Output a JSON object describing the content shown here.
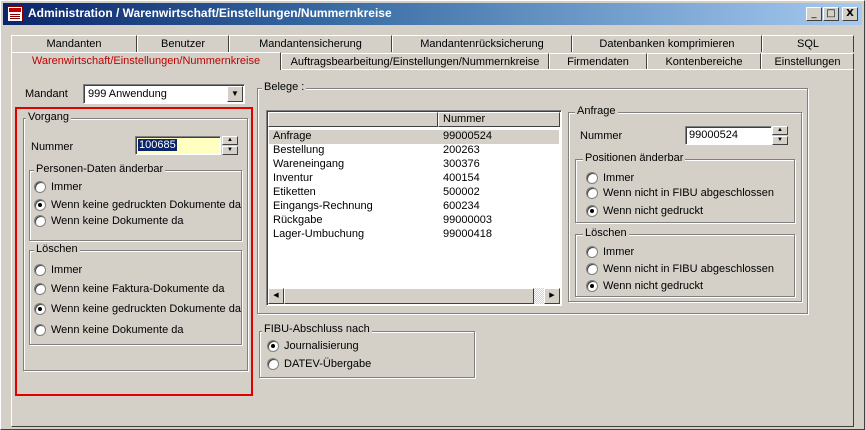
{
  "window": {
    "title": "Administration / Warenwirtschaft/Einstellungen/Nummernkreise",
    "minimize_label": "_",
    "maximize_label": "□",
    "close_label": "X"
  },
  "tabs_row1": [
    {
      "label": "Mandanten"
    },
    {
      "label": "Benutzer"
    },
    {
      "label": "Mandantensicherung"
    },
    {
      "label": "Mandantenrücksicherung"
    },
    {
      "label": "Datenbanken komprimieren"
    },
    {
      "label": "SQL"
    }
  ],
  "tabs_row2": [
    {
      "label": "Warenwirtschaft/Einstellungen/Nummernkreise",
      "active": true
    },
    {
      "label": "Auftragsbearbeitung/Einstellungen/Nummernkreise"
    },
    {
      "label": "Firmendaten"
    },
    {
      "label": "Kontenbereiche"
    },
    {
      "label": "Einstellungen"
    }
  ],
  "mandant": {
    "label": "Mandant",
    "value": "999 Anwendung"
  },
  "vorgang": {
    "title": "Vorgang",
    "nummer_label": "Nummer",
    "nummer_value": "100685",
    "personen": {
      "title": "Personen-Daten änderbar",
      "options": [
        "Immer",
        "Wenn keine gedruckten Dokumente da",
        "Wenn keine  Dokumente da"
      ],
      "selected": 1
    },
    "loeschen": {
      "title": "Löschen",
      "options": [
        "Immer",
        "Wenn keine  Faktura-Dokumente da",
        "Wenn keine gedruckten Dokumente da",
        "Wenn keine  Dokumente da"
      ],
      "selected": 2
    }
  },
  "belege": {
    "title": "Belege :",
    "columns": [
      "",
      "Nummer"
    ],
    "rows": [
      {
        "name": "Anfrage",
        "nummer": "99000524"
      },
      {
        "name": "Bestellung",
        "nummer": "200263"
      },
      {
        "name": "Wareneingang",
        "nummer": "300376"
      },
      {
        "name": "Inventur",
        "nummer": "400154"
      },
      {
        "name": "Etiketten",
        "nummer": "500002"
      },
      {
        "name": "Eingangs-Rechnung",
        "nummer": "600234"
      },
      {
        "name": "Rückgabe",
        "nummer": "99000003"
      },
      {
        "name": "Lager-Umbuchung",
        "nummer": "99000418"
      }
    ]
  },
  "anfrage": {
    "title": "Anfrage",
    "nummer_label": "Nummer",
    "nummer_value": "99000524",
    "positionen": {
      "title": "Positionen änderbar",
      "options": [
        "Immer",
        "Wenn nicht in FIBU abgeschlossen",
        "Wenn nicht gedruckt"
      ],
      "selected": 2
    },
    "loeschen": {
      "title": "Löschen",
      "options": [
        "Immer",
        "Wenn nicht in FIBU abgeschlossen",
        "Wenn nicht gedruckt"
      ],
      "selected": 2
    }
  },
  "fibu": {
    "title": "FIBU-Abschluss nach",
    "options": [
      "Journalisierung",
      "DATEV-Übergabe"
    ],
    "selected": 0
  },
  "colors": {
    "highlight": "#e00000",
    "active_tab": "#c00000",
    "selection": "#0a246a",
    "input_yellow": "#ffffc0"
  }
}
